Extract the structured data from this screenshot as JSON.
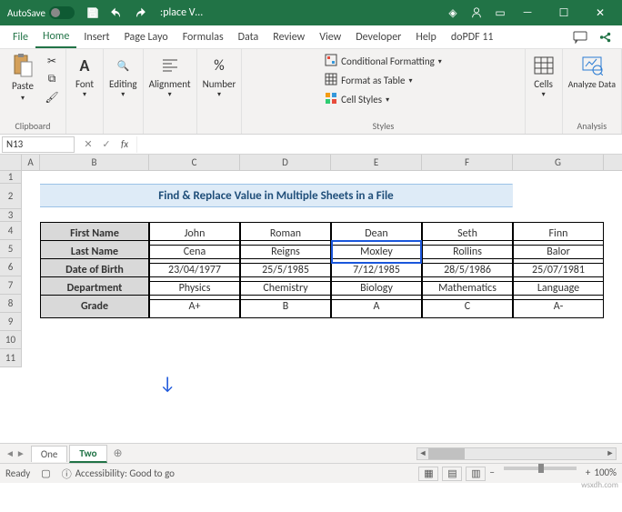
{
  "titlebar": {
    "autosave_label": "AutoSave",
    "doc_title": ":place V…"
  },
  "menu": {
    "file": "File",
    "home": "Home",
    "insert": "Insert",
    "pagelayout": "Page Layo",
    "formulas": "Formulas",
    "data": "Data",
    "review": "Review",
    "view": "View",
    "developer": "Developer",
    "help": "Help",
    "dopdf": "doPDF 11"
  },
  "ribbon": {
    "clipboard": {
      "paste": "Paste",
      "label": "Clipboard"
    },
    "font": {
      "btn": "Font",
      "label": ""
    },
    "editing": {
      "btn": "Editing",
      "label": ""
    },
    "alignment": {
      "btn": "Alignment",
      "label": ""
    },
    "number": {
      "btn": "Number",
      "label": ""
    },
    "styles": {
      "cond": "Conditional Formatting",
      "table": "Format as Table",
      "cell": "Cell Styles",
      "label": "Styles"
    },
    "cells": {
      "btn": "Cells",
      "label": ""
    },
    "analysis": {
      "btn": "Analyze Data",
      "label": "Analysis"
    }
  },
  "namebox": "N13",
  "sheet": {
    "columns": [
      "A",
      "B",
      "C",
      "D",
      "E",
      "F",
      "G"
    ],
    "rows": [
      "1",
      "2",
      "3",
      "4",
      "5",
      "6",
      "7",
      "8",
      "9",
      "10",
      "11"
    ],
    "title": "Find & Replace Value in Multiple Sheets in a File",
    "table": {
      "row_headers": [
        "First Name",
        "Last Name",
        "Date of Birth",
        "Department",
        "Grade"
      ],
      "data": [
        [
          "John",
          "Roman",
          "Dean",
          "Seth",
          "Finn"
        ],
        [
          "Cena",
          "Reigns",
          "Moxley",
          "Rollins",
          "Balor"
        ],
        [
          "23/04/1977",
          "25/5/1985",
          "7/12/1985",
          "28/5/1986",
          "25/07/1981"
        ],
        [
          "Physics",
          "Chemistry",
          "Biology",
          "Mathematics",
          "Language"
        ],
        [
          "A+",
          "B",
          "A",
          "C",
          "A-"
        ]
      ]
    }
  },
  "chart_data": {
    "type": "table",
    "title": "Find & Replace Value in Multiple Sheets in a File",
    "row_headers": [
      "First Name",
      "Last Name",
      "Date of Birth",
      "Department",
      "Grade"
    ],
    "columns": [
      {
        "First Name": "John",
        "Last Name": "Cena",
        "Date of Birth": "23/04/1977",
        "Department": "Physics",
        "Grade": "A+"
      },
      {
        "First Name": "Roman",
        "Last Name": "Reigns",
        "Date of Birth": "25/5/1985",
        "Department": "Chemistry",
        "Grade": "B"
      },
      {
        "First Name": "Dean",
        "Last Name": "Moxley",
        "Date of Birth": "7/12/1985",
        "Department": "Biology",
        "Grade": "A"
      },
      {
        "First Name": "Seth",
        "Last Name": "Rollins",
        "Date of Birth": "28/5/1986",
        "Department": "Mathematics",
        "Grade": "C"
      },
      {
        "First Name": "Finn",
        "Last Name": "Balor",
        "Date of Birth": "25/07/1981",
        "Department": "Language",
        "Grade": "A-"
      }
    ]
  },
  "sheettabs": {
    "one": "One",
    "two": "Two"
  },
  "statusbar": {
    "ready": "Ready",
    "accessibility": "Accessibility: Good to go",
    "zoom": "100%"
  },
  "watermark": "wsxdh.com"
}
